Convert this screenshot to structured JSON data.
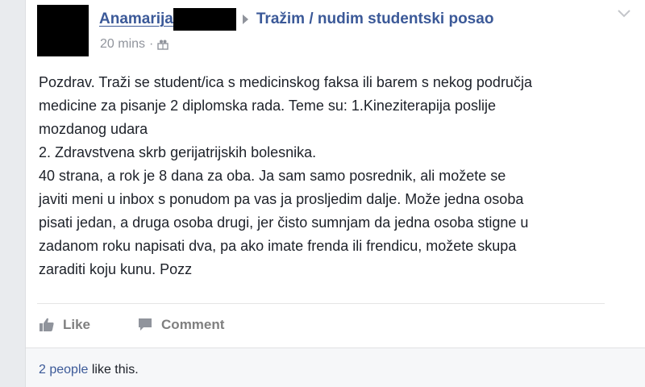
{
  "post": {
    "author_name": "Anamarija",
    "group_name": "Tražim / nudim studentski posao",
    "timestamp": "20 mins",
    "meta_separator": "·",
    "audience_icon": "group-icon",
    "body": "Pozdrav. Traži se student/ica s medicinskog faksa ili barem s nekog područja\nmedicine za pisanje 2 diplomska rada. Teme su: 1.Kineziterapija poslije\nmozdanog udara\n2. Zdravstvena skrb gerijatrijskih bolesnika.\n40 strana, a rok je 8 dana za oba. Ja sam samo posrednik, ali možete se\njaviti meni u inbox s ponudom pa vas ja prosljedim dalje. Može jedna osoba\npisati jedan, a druga osoba drugi, jer čisto sumnjam da jedna osoba stigne u\nzadanom roku napisati dva, pa ako imate frenda ili frendicu, možete skupa\nzaraditi koju kunu. Pozz"
  },
  "actions": {
    "like_label": "Like",
    "comment_label": "Comment"
  },
  "likes": {
    "link_text": "2 people",
    "suffix": " like this."
  },
  "colors": {
    "link": "#3b5998",
    "muted": "#90949c",
    "action": "#7f7f7f",
    "redaction": "#000000"
  }
}
